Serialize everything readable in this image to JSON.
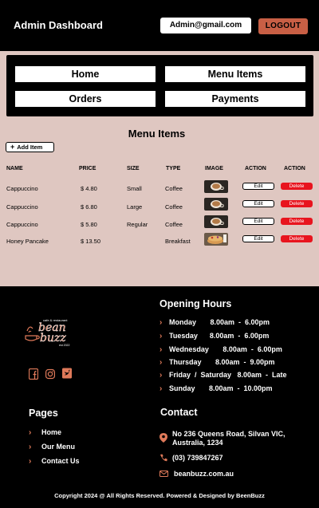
{
  "header": {
    "title": "Admin Dashboard",
    "email": "Admin@gmail.com",
    "logout_label": "LOGOUT"
  },
  "nav": {
    "home": "Home",
    "menu_items": "Menu Items",
    "orders": "Orders",
    "payments": "Payments"
  },
  "menu": {
    "title": "Menu Items",
    "add_label": "Add Item",
    "columns": [
      "NAME",
      "PRICE",
      "SIZE",
      "TYPE",
      "IMAGE",
      "ACTION",
      "ACTION"
    ],
    "rows": [
      {
        "name": "Cappuccino",
        "price": "$ 4.80",
        "size": "Small",
        "type": "Coffee",
        "image": "coffee-cup",
        "edit": "Edit",
        "delete": "Delete"
      },
      {
        "name": "Cappuccino",
        "price": "$ 6.80",
        "size": "Large",
        "type": "Coffee",
        "image": "coffee-cup",
        "edit": "Edit",
        "delete": "Delete"
      },
      {
        "name": "Cappuccino",
        "price": "$ 5.80",
        "size": "Regular",
        "type": "Coffee",
        "image": "coffee-cup",
        "edit": "Edit",
        "delete": "Delete"
      },
      {
        "name": "Honey Pancake",
        "price": "$ 13.50",
        "size": "",
        "type": "Breakfast",
        "image": "pancake",
        "edit": "Edit",
        "delete": "Delete"
      }
    ]
  },
  "footer": {
    "logo": {
      "text": "bean buzz",
      "tag": "cafe & restaurant",
      "est": "est 2022"
    },
    "social": [
      "facebook-icon",
      "instagram-icon",
      "twitter-icon"
    ],
    "hours_title": "Opening Hours",
    "hours": [
      "Monday       8.00am  -  6.00pm",
      "Tuesday      8.00am  -  6.00pm",
      "Wednesday       8.00am  -  6.00pm",
      "Thursday       8.00am  -  9.00pm",
      "Friday  /  Saturday   8.00am  -  Late",
      "Sunday       8.00am  -  10.00pm"
    ],
    "pages_title": "Pages",
    "pages": [
      "Home",
      "Our Menu",
      "Contact Us"
    ],
    "contact_title": "Contact",
    "address_line1": "No 236 Queens Road, Silvan VIC,",
    "address_line2": "Australia, 1234",
    "phone": "(03) 739847267",
    "website": "beanbuzz.com.au",
    "copyright": "Copyright 2024 @ All Rights Reserved. Powered & Designed by BeenBuzz"
  },
  "colors": {
    "accent": "#e07a5a",
    "logout_bg": "#c85f45",
    "main_bg": "#dfc7c1",
    "delete_bg": "#e8141e"
  }
}
